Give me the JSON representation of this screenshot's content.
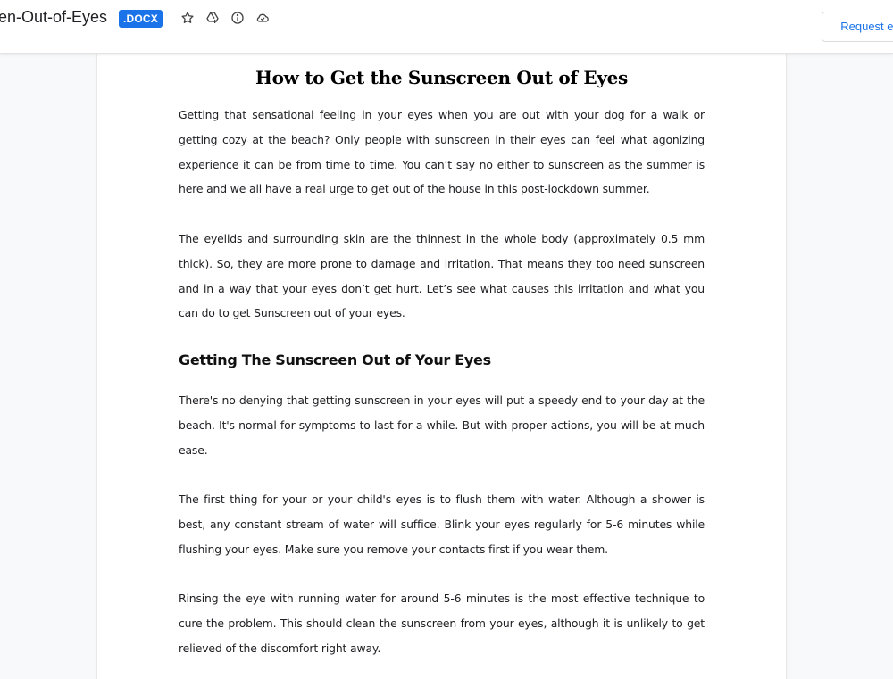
{
  "header": {
    "doc_title": "en-Out-of-Eyes",
    "file_type": ".DOCX",
    "icons": [
      "star-icon",
      "add-to-drive-icon",
      "info-icon",
      "cloud-icon"
    ],
    "request_button": "Request ed"
  },
  "document": {
    "title": "How to Get the Sunscreen Out of Eyes",
    "paragraphs": [
      "Getting that sensational feeling in your eyes when you are out with your dog for a walk or getting cozy at the beach? Only people with sunscreen in their eyes can feel what agonizing experience it can be from time to time. You can’t say no either to sunscreen as the summer is here and we all have a real urge to get out of the house in this post-lockdown summer.",
      "The eyelids and surrounding skin are the thinnest in the whole body (approximately 0.5 mm thick). So, they are more prone to damage and irritation. That means they too need sunscreen and in a way that your eyes don’t get hurt. Let’s see what causes this irritation and what you can do to get Sunscreen out of your eyes."
    ],
    "section_heading": "Getting The Sunscreen Out of Your Eyes",
    "section_paragraphs": [
      "There's no denying that getting sunscreen in your eyes will put a speedy end to your day at the beach. It's normal for symptoms to last for a while. But with proper actions, you will be at much ease.",
      "The first thing for your or your child's eyes is to flush them with water. Although a shower is best, any constant stream of water will suffice. Blink your eyes regularly for 5-6 minutes while flushing your eyes. Make sure you remove your contacts first if you wear them.",
      "Rinsing the eye with running water for around 5-6 minutes is the most effective technique to cure the problem. This should clean the sunscreen from your eyes, although it is unlikely to get relieved of the discomfort right away."
    ]
  },
  "colors": {
    "accent": "#1a73e8",
    "page_bg": "#f8f9fa"
  }
}
